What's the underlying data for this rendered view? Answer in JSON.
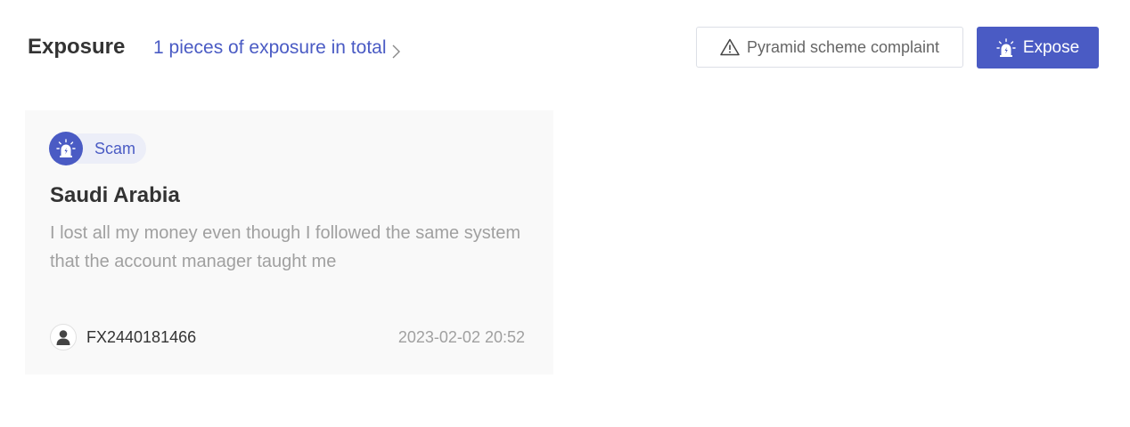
{
  "header": {
    "title": "Exposure",
    "count_link": "1 pieces of exposure in total",
    "icons": {
      "count_link": "chevron-right-icon"
    }
  },
  "actions": {
    "complaint_label": "Pyramid scheme complaint",
    "complaint_icon": "warning-triangle-icon",
    "expose_label": "Expose",
    "expose_icon": "alarm-light-icon"
  },
  "colors": {
    "accent": "#4a5bc4",
    "tag_bg": "#eceef8",
    "card_bg": "#f9f9f9",
    "muted_text": "#a0a0a0",
    "title_text": "#333333"
  },
  "cards": [
    {
      "tag": "Scam",
      "tag_icon": "alarm-light-icon",
      "title": "Saudi Arabia",
      "description": "I lost all my money even though I followed the same system that the account manager taught me",
      "user": "FX2440181466",
      "user_icon": "user-avatar-icon",
      "time": "2023-02-02 20:52"
    }
  ]
}
